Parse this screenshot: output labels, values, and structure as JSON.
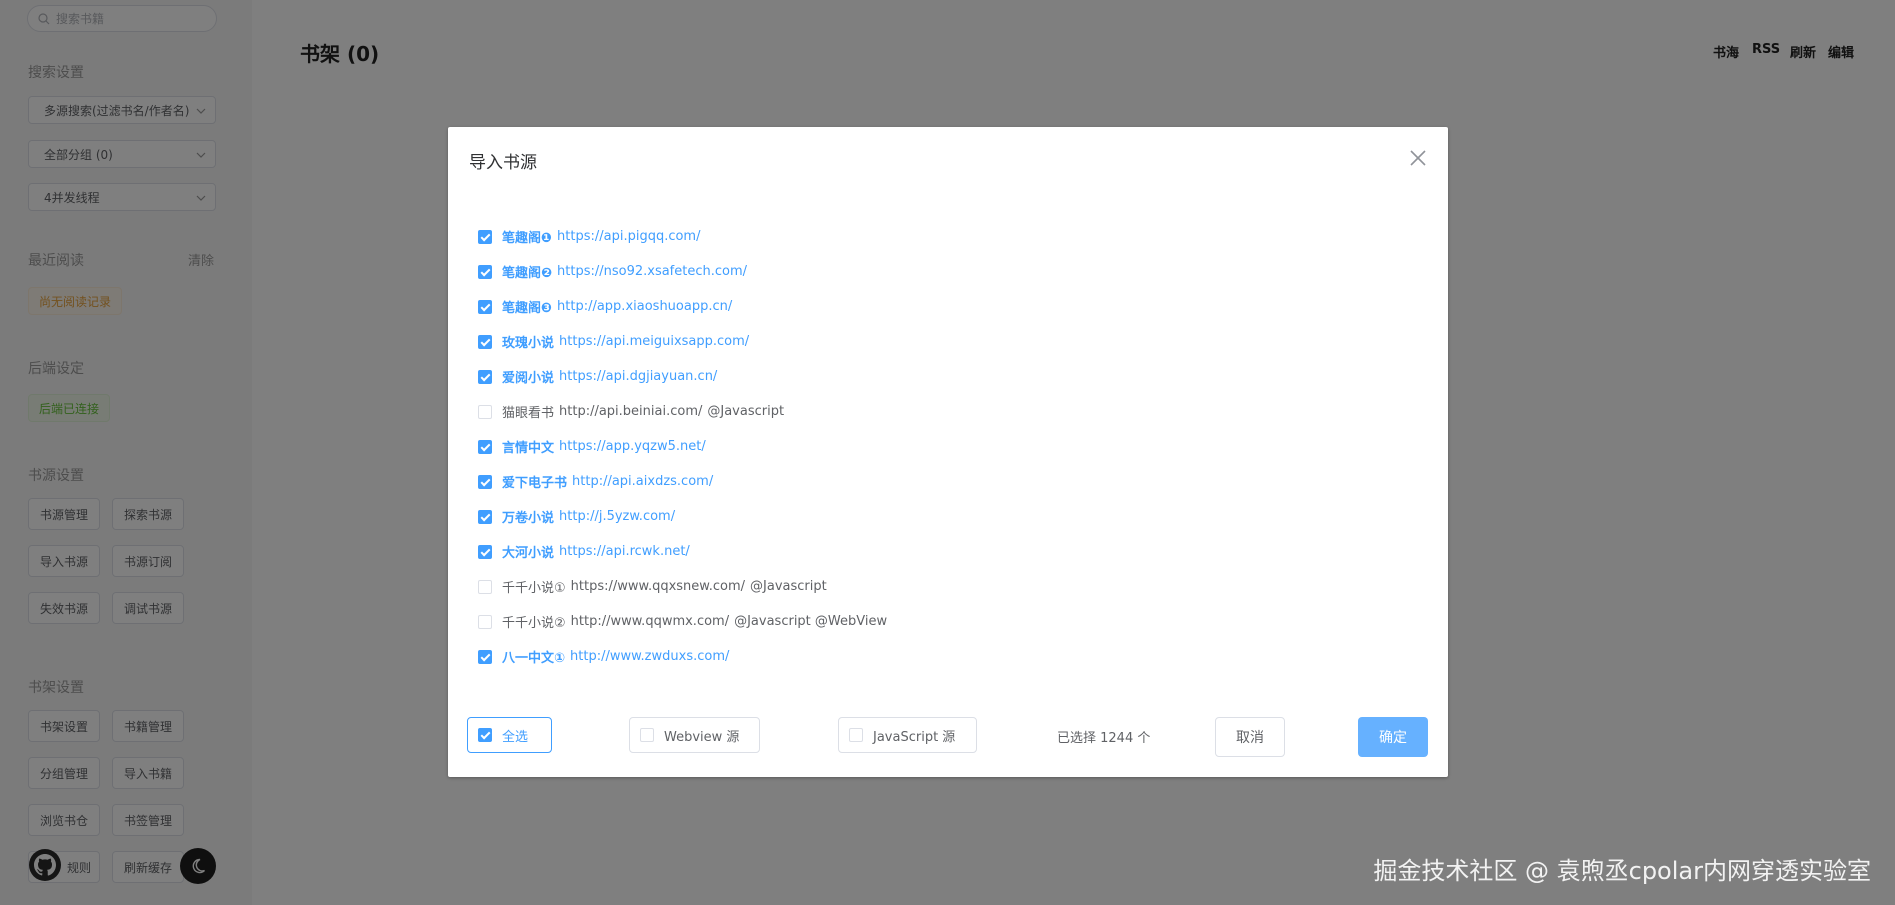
{
  "sidebar": {
    "search_placeholder": "搜索书籍",
    "search_settings_title": "搜索设置",
    "select_search_mode": "多源搜索(过滤书名/作者名)",
    "select_group": "全部分组 (0)",
    "select_threads": "4并发线程",
    "recent_title": "最近阅读",
    "recent_clear": "清除",
    "recent_empty": "尚无阅读记录",
    "backend_title": "后端设定",
    "backend_status": "后端已连接",
    "source_settings_title": "书源设置",
    "source_buttons": [
      "书源管理",
      "探索书源",
      "导入书源",
      "书源订阅",
      "失效书源",
      "调试书源"
    ],
    "shelf_settings_title": "书架设置",
    "shelf_buttons": [
      "书架设置",
      "书籍管理",
      "分组管理",
      "导入书籍",
      "浏览书仓",
      "书签管理",
      "规则",
      "刷新缓存"
    ]
  },
  "main": {
    "title": "书架 (0)",
    "nav": [
      "书海",
      "RSS",
      "刷新",
      "编辑"
    ]
  },
  "dialog": {
    "title": "导入书源",
    "items": [
      {
        "name": "笔趣阁❶",
        "url": "https://api.pigqq.com/",
        "tags": "",
        "checked": true
      },
      {
        "name": "笔趣阁❷",
        "url": "https://nso92.xsafetech.com/",
        "tags": "",
        "checked": true
      },
      {
        "name": "笔趣阁❸",
        "url": "http://app.xiaoshuoapp.cn/",
        "tags": "",
        "checked": true
      },
      {
        "name": "玫瑰小说",
        "url": "https://api.meiguixsapp.com/",
        "tags": "",
        "checked": true
      },
      {
        "name": "爱阅小说",
        "url": "https://api.dgjiayuan.cn/",
        "tags": "",
        "checked": true
      },
      {
        "name": "猫眼看书",
        "url": "http://api.beiniai.com/",
        "tags": "@Javascript",
        "checked": false
      },
      {
        "name": "言情中文",
        "url": "https://app.yqzw5.net/",
        "tags": "",
        "checked": true
      },
      {
        "name": "爱下电子书",
        "url": "http://api.aixdzs.com/",
        "tags": "",
        "checked": true
      },
      {
        "name": "万卷小说",
        "url": "http://j.5yzw.com/",
        "tags": "",
        "checked": true
      },
      {
        "name": "大河小说",
        "url": "https://api.rcwk.net/",
        "tags": "",
        "checked": true
      },
      {
        "name": "千千小说①",
        "url": "https://www.qqxsnew.com/",
        "tags": "@Javascript",
        "checked": false
      },
      {
        "name": "千千小说②",
        "url": "http://www.qqwmx.com/",
        "tags": "@Javascript @WebView",
        "checked": false
      },
      {
        "name": "八一中文①",
        "url": "http://www.zwduxs.com/",
        "tags": "",
        "checked": true
      }
    ],
    "select_all_label": "全选",
    "webview_label": "Webview 源",
    "javascript_label": "JavaScript 源",
    "selected_count": "已选择 1244 个",
    "cancel_label": "取消",
    "confirm_label": "确定"
  },
  "watermark": "掘金技术社区 @ 袁煦丞cpolar内网穿透实验室",
  "colors": {
    "primary": "#409eff",
    "confirm": "#66b1ff",
    "overlay": "rgba(0,0,0,0.5)"
  }
}
